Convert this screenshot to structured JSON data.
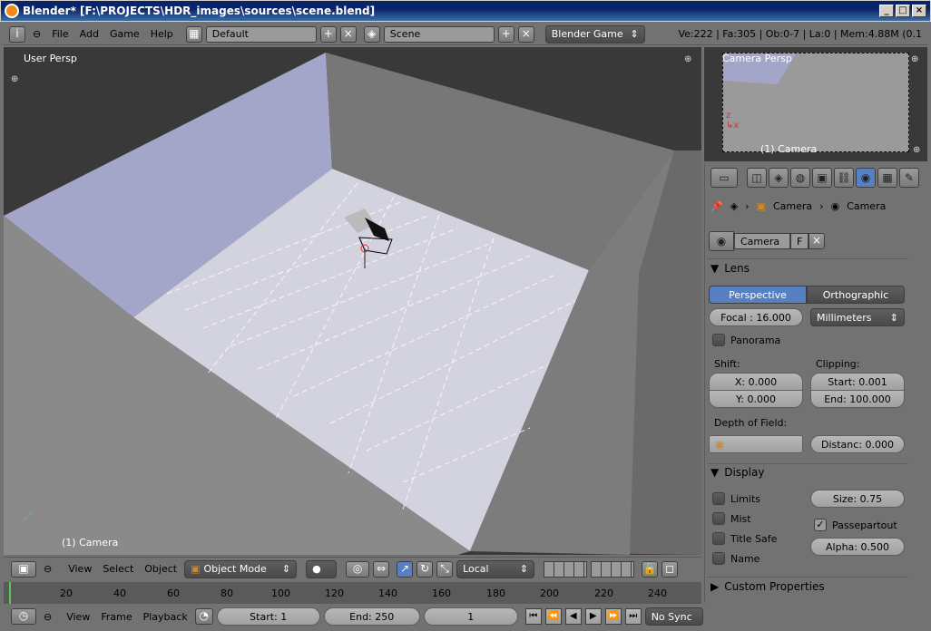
{
  "window": {
    "title": "Blender* [F:\\PROJECTS\\HDR_images\\sources\\scene.blend]"
  },
  "info_header": {
    "menus": [
      "File",
      "Add",
      "Game",
      "Help"
    ],
    "screen_layout": "Default",
    "scene": "Scene",
    "engine": "Blender Game",
    "stats": "Ve:222 | Fa:305 | Ob:0-7 | La:0 | Mem:4.88M (0.1"
  },
  "viewport": {
    "view_label": "User Persp",
    "object_label": "(1) Camera"
  },
  "camera_preview": {
    "view_label": "Camera Persp",
    "object_label": "(1) Camera"
  },
  "properties": {
    "breadcrumb": [
      "Camera",
      "Camera"
    ],
    "datablock_name": "Camera",
    "datablock_flag": "F",
    "lens_panel": {
      "title": "Lens",
      "projection_options": [
        "Perspective",
        "Orthographic"
      ],
      "projection_selected": "Perspective",
      "focal": "Focal : 16.000",
      "units": "Millimeters",
      "panorama_label": "Panorama",
      "panorama_checked": false,
      "shift_label": "Shift:",
      "shift_x": "X: 0.000",
      "shift_y": "Y: 0.000",
      "clipping_label": "Clipping:",
      "clip_start": "Start: 0.001",
      "clip_end": "End: 100.000",
      "dof_label": "Depth of Field:",
      "dof_distance": "Distanc: 0.000"
    },
    "display_panel": {
      "title": "Display",
      "limits_label": "Limits",
      "limits_checked": false,
      "mist_label": "Mist",
      "mist_checked": false,
      "title_safe_label": "Title Safe",
      "title_safe_checked": false,
      "name_label": "Name",
      "name_checked": false,
      "size": "Size: 0.75",
      "passepartout_label": "Passepartout",
      "passepartout_checked": true,
      "alpha": "Alpha: 0.500"
    },
    "custom_props_title": "Custom Properties"
  },
  "view3d_header": {
    "menus": [
      "View",
      "Select",
      "Object"
    ],
    "mode": "Object Mode",
    "orientation": "Local"
  },
  "timeline": {
    "ticks": [
      "20",
      "40",
      "60",
      "80",
      "100",
      "120",
      "140",
      "160",
      "180",
      "200",
      "220",
      "240"
    ],
    "menus": [
      "View",
      "Frame",
      "Playback"
    ],
    "start": "Start: 1",
    "end": "End: 250",
    "current": "1",
    "sync": "No Sync"
  },
  "colors": {
    "accent": "#5680c2",
    "panel": "#727272",
    "viewport": "#393939"
  }
}
